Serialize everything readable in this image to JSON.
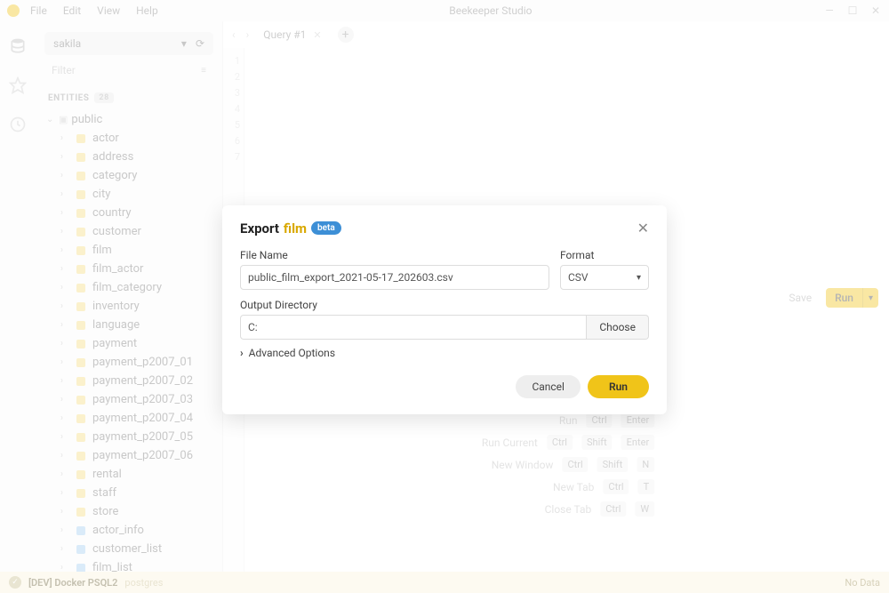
{
  "titlebar": {
    "menus": [
      "File",
      "Edit",
      "View",
      "Help"
    ],
    "app_title": "Beekeeper Studio"
  },
  "sidebar": {
    "database_selected": "sakila",
    "filter_placeholder": "Filter",
    "section_label": "ENTITIES",
    "entity_count": "28",
    "schema_name": "public",
    "tables": [
      {
        "name": "actor",
        "kind": "table"
      },
      {
        "name": "address",
        "kind": "table"
      },
      {
        "name": "category",
        "kind": "table"
      },
      {
        "name": "city",
        "kind": "table"
      },
      {
        "name": "country",
        "kind": "table"
      },
      {
        "name": "customer",
        "kind": "table"
      },
      {
        "name": "film",
        "kind": "table"
      },
      {
        "name": "film_actor",
        "kind": "table"
      },
      {
        "name": "film_category",
        "kind": "table"
      },
      {
        "name": "inventory",
        "kind": "table"
      },
      {
        "name": "language",
        "kind": "table"
      },
      {
        "name": "payment",
        "kind": "table"
      },
      {
        "name": "payment_p2007_01",
        "kind": "table"
      },
      {
        "name": "payment_p2007_02",
        "kind": "table"
      },
      {
        "name": "payment_p2007_03",
        "kind": "table"
      },
      {
        "name": "payment_p2007_04",
        "kind": "table"
      },
      {
        "name": "payment_p2007_05",
        "kind": "table"
      },
      {
        "name": "payment_p2007_06",
        "kind": "table"
      },
      {
        "name": "rental",
        "kind": "table"
      },
      {
        "name": "staff",
        "kind": "table"
      },
      {
        "name": "store",
        "kind": "table"
      },
      {
        "name": "actor_info",
        "kind": "view"
      },
      {
        "name": "customer_list",
        "kind": "view"
      },
      {
        "name": "film_list",
        "kind": "view"
      }
    ]
  },
  "tabs": {
    "active_label": "Query #1"
  },
  "actions": {
    "save_label": "Save",
    "run_label": "Run"
  },
  "shortcuts": [
    {
      "label": "Run",
      "keys": [
        "Ctrl",
        "Enter"
      ]
    },
    {
      "label": "Run Current",
      "keys": [
        "Ctrl",
        "Shift",
        "Enter"
      ]
    },
    {
      "label": "New Window",
      "keys": [
        "Ctrl",
        "Shift",
        "N"
      ]
    },
    {
      "label": "New Tab",
      "keys": [
        "Ctrl",
        "T"
      ]
    },
    {
      "label": "Close Tab",
      "keys": [
        "Ctrl",
        "W"
      ]
    }
  ],
  "statusbar": {
    "connection": "[DEV] Docker PSQL2",
    "user": "postgres",
    "right": "No Data"
  },
  "modal": {
    "title_prefix": "Export",
    "title_entity": "film",
    "beta_label": "beta",
    "file_name_label": "File Name",
    "file_name_value": "public_film_export_2021-05-17_202603.csv",
    "format_label": "Format",
    "format_value": "CSV",
    "output_dir_label": "Output Directory",
    "output_dir_value": "C:",
    "choose_label": "Choose",
    "advanced_label": "Advanced Options",
    "cancel_label": "Cancel",
    "run_label": "Run"
  }
}
